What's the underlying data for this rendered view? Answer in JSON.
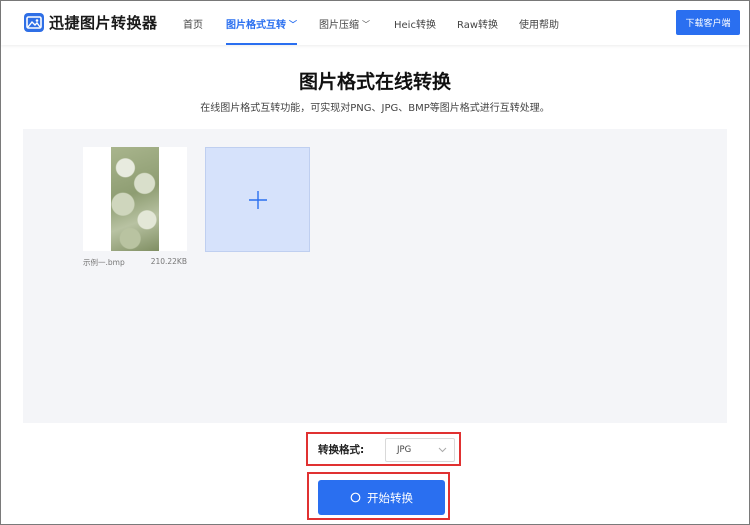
{
  "header": {
    "logo_text": "迅捷图片转换器",
    "nav": [
      {
        "label": "首页",
        "active": false,
        "dropdown": false
      },
      {
        "label": "图片格式互转",
        "active": true,
        "dropdown": true
      },
      {
        "label": "图片压缩",
        "active": false,
        "dropdown": true
      },
      {
        "label": "Heic转换",
        "active": false,
        "dropdown": false
      },
      {
        "label": "Raw转换",
        "active": false,
        "dropdown": false
      },
      {
        "label": "使用帮助",
        "active": false,
        "dropdown": false
      }
    ],
    "download_label": "下载客户端"
  },
  "main": {
    "title": "图片格式在线转换",
    "subtitle": "在线图片格式互转功能，可实现对PNG、JPG、BMP等图片格式进行互转处理。"
  },
  "files": [
    {
      "name": "示例一.bmp",
      "size": "210.22KB"
    }
  ],
  "format": {
    "label": "转换格式:",
    "selected": "JPG"
  },
  "start_label": "开始转换",
  "colors": {
    "accent": "#2a6ff0",
    "highlight": "#e03131"
  }
}
